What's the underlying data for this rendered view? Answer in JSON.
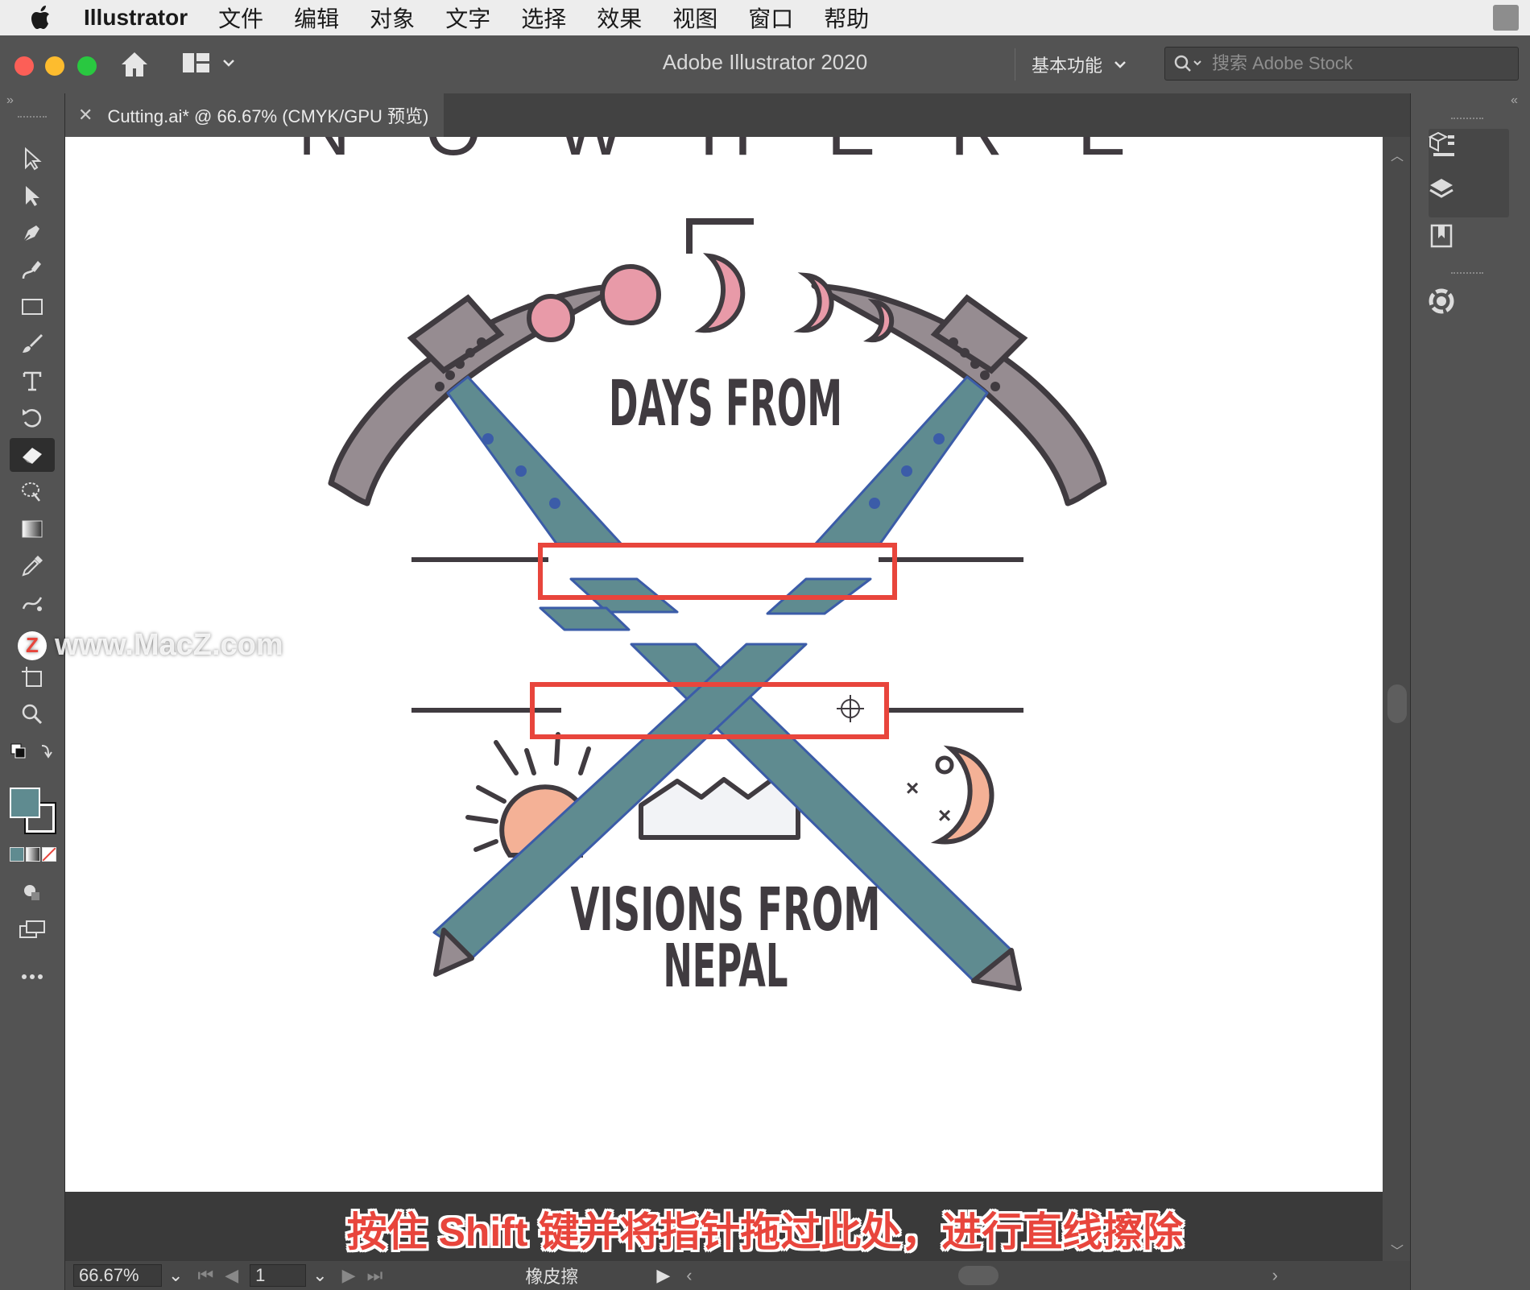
{
  "menubar": {
    "app_name": "Illustrator",
    "items": [
      "文件",
      "编辑",
      "对象",
      "文字",
      "选择",
      "效果",
      "视图",
      "窗口",
      "帮助"
    ]
  },
  "titlebar": {
    "title": "Adobe Illustrator 2020",
    "workspace": "基本功能",
    "search_placeholder": "搜索 Adobe Stock"
  },
  "document": {
    "tab_label": "Cutting.ai* @ 66.67% (CMYK/GPU 预览)"
  },
  "artwork": {
    "top_text": "N O W H E R E",
    "number": "5",
    "line1": "DAYS FROM",
    "line2": "VISIONS FROM",
    "line3": "NEPAL"
  },
  "statusbar": {
    "zoom": "66.67%",
    "artboard": "1",
    "current_tool": "橡皮擦"
  },
  "watermark": "www.MacZ.com",
  "subtitle": "按住 Shift 键并将指针拖过此处，进行直线擦除",
  "colors": {
    "accent_red": "#e8453c",
    "shaft": "#5f8b90",
    "moon_pink": "#e89aa8",
    "sun_peach": "#f4b196",
    "pick_grey": "#968c91"
  }
}
